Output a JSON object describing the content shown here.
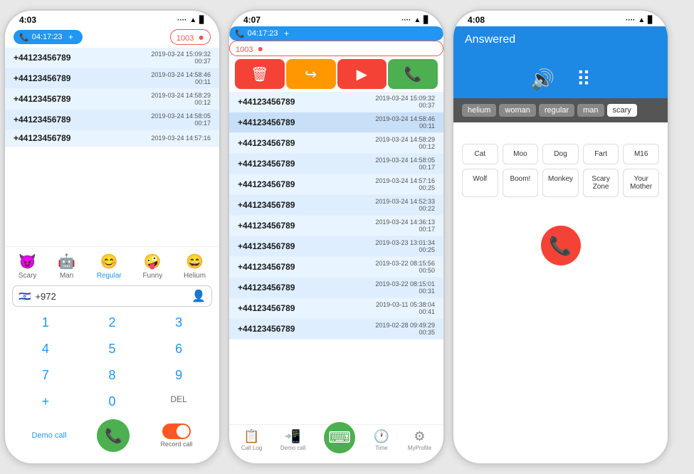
{
  "phone1": {
    "status_time": "4:03",
    "timer": "04:17:23",
    "call_count": "1003",
    "calls": [
      {
        "number": "+44123456789",
        "date": "2019-03-24 15:09:32",
        "duration": "00:37"
      },
      {
        "number": "+44123456789",
        "date": "2019-03-24 14:58:46",
        "duration": "00:11"
      },
      {
        "number": "+44123456789",
        "date": "2019-03-24 14:58:29",
        "duration": "00:12"
      },
      {
        "number": "+44123456789",
        "date": "2019-03-24 14:58:05",
        "duration": "00:17"
      },
      {
        "number": "+44123456789",
        "date": "2019-03-24 14:57:16",
        "duration": ""
      }
    ],
    "voice_options": [
      {
        "label": "Scary",
        "active": false
      },
      {
        "label": "Man",
        "active": false
      },
      {
        "label": "Regular",
        "active": true
      },
      {
        "label": "Funny",
        "active": false
      },
      {
        "label": "Helium",
        "active": false
      }
    ],
    "phone_number": "+972",
    "dialpad": [
      "1",
      "2",
      "3",
      "4",
      "5",
      "6",
      "7",
      "8",
      "9",
      "+",
      "0",
      "DEL"
    ],
    "demo_call": "Demo call",
    "record_call": "Record call"
  },
  "phone2": {
    "status_time": "4:07",
    "timer": "04:17:23",
    "call_count": "1003",
    "calls": [
      {
        "number": "+44123456789",
        "date": "2019-03-24 15:09:32",
        "duration": "00:37"
      },
      {
        "number": "+44123456789",
        "date": "2019-03-24 14:58:46",
        "duration": "00:11"
      },
      {
        "number": "+44123456789",
        "date": "2019-03-24 14:58:29",
        "duration": "00:12"
      },
      {
        "number": "+44123456789",
        "date": "2019-03-24 14:58:05",
        "duration": "00:17"
      },
      {
        "number": "+44123456789",
        "date": "2019-03-24 14:57:16",
        "duration": "00:25"
      },
      {
        "number": "+44123456789",
        "date": "2019-03-24 14:52:33",
        "duration": "00:22"
      },
      {
        "number": "+44123456789",
        "date": "2019-03-24 14:36:13",
        "duration": "00:17"
      },
      {
        "number": "+44123456789",
        "date": "2019-03-23 13:01:34",
        "duration": "00:25"
      },
      {
        "number": "+44123456789",
        "date": "2019-03-22 08:15:56",
        "duration": "00:50"
      },
      {
        "number": "+44123456789",
        "date": "2019-03-22 08:15:01",
        "duration": "00:31"
      },
      {
        "number": "+44123456789",
        "date": "2019-03-11 05:38:04",
        "duration": "00:41"
      },
      {
        "number": "+44123456789",
        "date": "2019-02-28 09:49:29",
        "duration": "00:35"
      }
    ],
    "nav": [
      {
        "label": "Call Log",
        "active": false
      },
      {
        "label": "Demo call",
        "active": false
      },
      {
        "label": "",
        "active": false
      },
      {
        "label": "Time",
        "active": false
      },
      {
        "label": "MyProfile",
        "active": false
      }
    ]
  },
  "phone3": {
    "status_time": "4:08",
    "answered_label": "Answered",
    "voice_tabs": [
      "helium",
      "woman",
      "regular",
      "man",
      "scary"
    ],
    "active_tab": "scary",
    "sound_buttons": [
      [
        "Cat",
        "Moo",
        "Dog",
        "Fart",
        "M16"
      ],
      [
        "Wolf",
        "Boom!",
        "Monkey",
        "Scary Zone",
        "Your Mother"
      ]
    ]
  }
}
